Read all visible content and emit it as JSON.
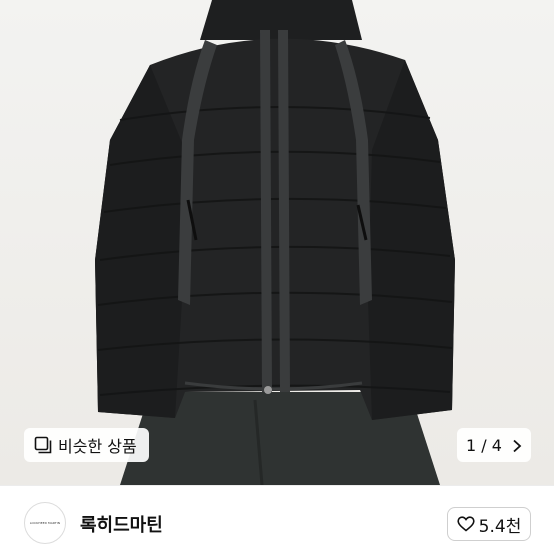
{
  "product": {
    "photo_icon": "product-photo-black-puffer-jacket"
  },
  "similar": {
    "label": "비슷한 상품",
    "icon": "similar-items-icon"
  },
  "pager": {
    "current": "1",
    "separator": "/",
    "total": "4",
    "text": "1 / 4"
  },
  "seller": {
    "name": "록히드마틴",
    "avatar_logo_text": "LOCKHEED MARTIN"
  },
  "likes": {
    "count": "5.4천",
    "icon": "heart-icon"
  }
}
